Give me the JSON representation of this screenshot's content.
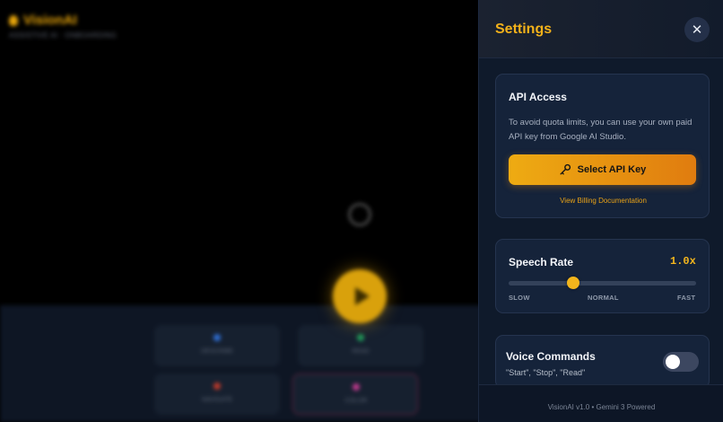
{
  "background_app": {
    "title": "VisionAI",
    "subtitle": "ASSISTIVE AI · ONBOARDING",
    "tiles": [
      {
        "label": "DESCRIBE",
        "color": "#2f6fd6"
      },
      {
        "label": "READ",
        "color": "#1f9a5a"
      },
      {
        "label": "NAVIGATE",
        "color": "#c0392b"
      },
      {
        "label": "COLOR",
        "color": "#c0398e"
      }
    ]
  },
  "settings": {
    "title": "Settings",
    "close_icon": "close-icon",
    "api_access": {
      "title": "API Access",
      "description": "To avoid quota limits, you can use your own paid API key from Google AI Studio.",
      "button_label": "Select API Key",
      "button_icon": "key-icon",
      "link_label": "View Billing Documentation"
    },
    "speech_rate": {
      "title": "Speech Rate",
      "value_label": "1.0x",
      "value": 1.0,
      "min_label": "SLOW",
      "mid_label": "NORMAL",
      "max_label": "FAST",
      "slider_fraction": 0.345
    },
    "voice_commands": {
      "title": "Voice Commands",
      "subtitle": "\"Start\", \"Stop\", \"Read\"",
      "enabled": false
    },
    "footer": "VisionAI v1.0 • Gemini 3 Powered"
  },
  "colors": {
    "accent": "#f2b11a",
    "panel": "#0f1a2b",
    "card": "#15233a"
  }
}
